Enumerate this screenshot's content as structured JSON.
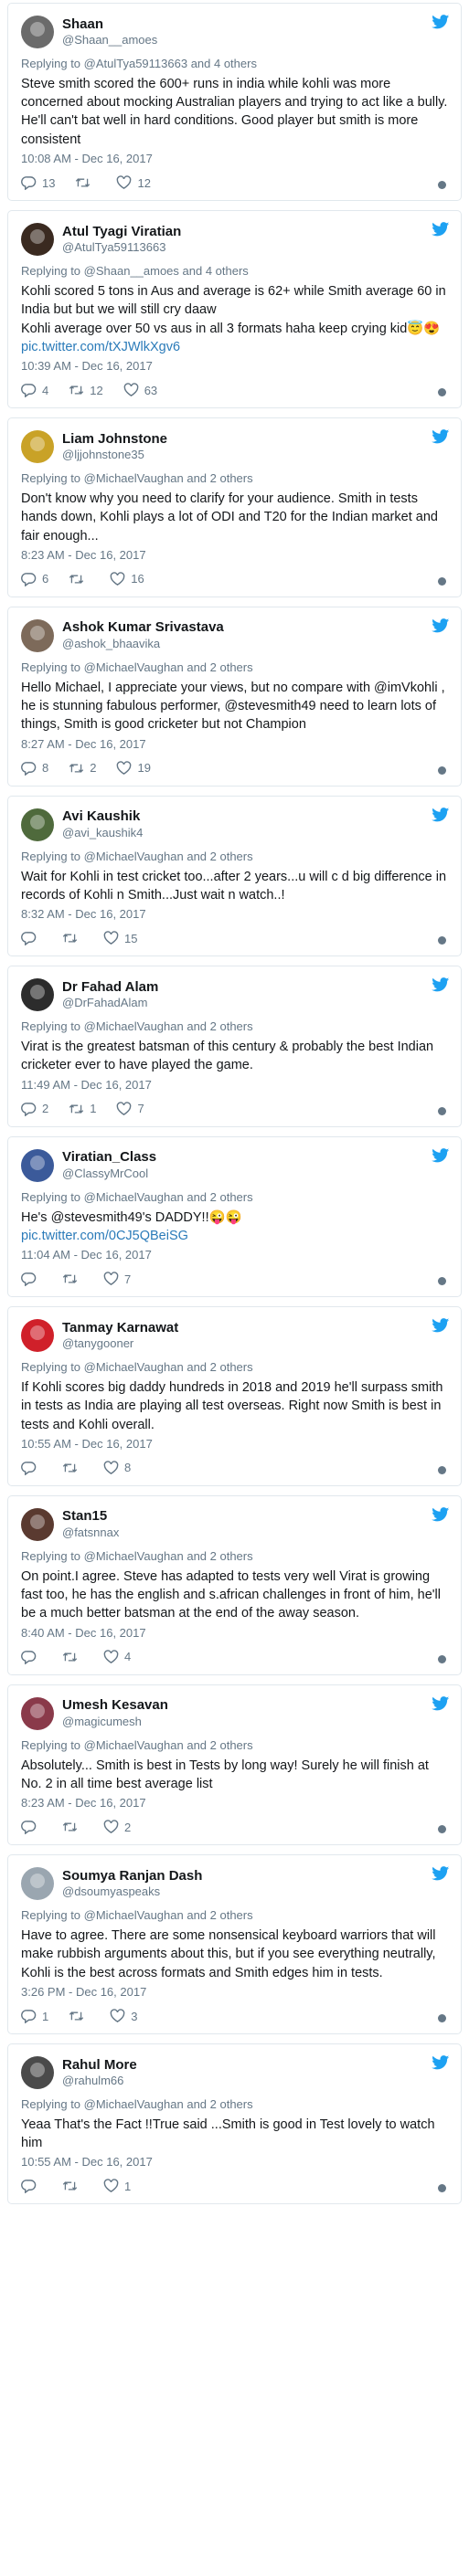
{
  "tweets": [
    {
      "name": "Shaan",
      "handle": "@Shaan__amoes",
      "avatar_color": "#6b6b6b",
      "replying": "Replying to @AtulTya59113663 and 4 others",
      "text": "Steve smith scored the 600+ runs in india while kohli was more concerned about mocking Australian players and trying to act like a bully. He'll can't bat well in hard conditions. Good player but smith is more consistent",
      "emoji": "",
      "link": "",
      "time": "10:08 AM - Dec 16, 2017",
      "replies": "13",
      "retweets": "",
      "likes": "12"
    },
    {
      "name": "Atul Tyagi Viratian",
      "handle": "@AtulTya59113663",
      "avatar_color": "#3a2a20",
      "replying": "Replying to @Shaan__amoes and 4 others",
      "text": "Kohli scored 5 tons in Aus and average is 62+ while Smith average 60 in India but but we will still cry daaw\nKohli average over 50 vs aus in all 3 formats haha keep crying kid",
      "emoji": "😇😍",
      "link": "pic.twitter.com/tXJWlkXgv6",
      "time": "10:39 AM - Dec 16, 2017",
      "replies": "4",
      "retweets": "12",
      "likes": "63"
    },
    {
      "name": "Liam Johnstone",
      "handle": "@ljjohnstone35",
      "avatar_color": "#c9a227",
      "replying": "Replying to @MichaelVaughan and 2 others",
      "text": "Don't know why you need to clarify for your audience. Smith in tests hands down, Kohli plays a lot of ODI and T20 for the Indian market and fair enough...",
      "emoji": "",
      "link": "",
      "time": "8:23 AM - Dec 16, 2017",
      "replies": "6",
      "retweets": "",
      "likes": "16"
    },
    {
      "name": "Ashok Kumar Srivastava",
      "handle": "@ashok_bhaavika",
      "avatar_color": "#7d6a5a",
      "replying": "Replying to @MichaelVaughan and 2 others",
      "text": "Hello Michael, I appreciate your views, but no compare with @imVkohli , he is stunning fabulous performer, @stevesmith49 need to learn lots of things, Smith is good cricketer but not Champion",
      "emoji": "",
      "link": "",
      "time": "8:27 AM - Dec 16, 2017",
      "replies": "8",
      "retweets": "2",
      "likes": "19"
    },
    {
      "name": "Avi Kaushik",
      "handle": "@avi_kaushik4",
      "avatar_color": "#4f6a3c",
      "replying": "Replying to @MichaelVaughan and 2 others",
      "text": "Wait for Kohli in test cricket too...after 2 years...u will c d big difference in records of Kohli n Smith...Just wait n watch..!",
      "emoji": "",
      "link": "",
      "time": "8:32 AM - Dec 16, 2017",
      "replies": "",
      "retweets": "",
      "likes": "15"
    },
    {
      "name": "Dr Fahad Alam",
      "handle": "@DrFahadAlam",
      "avatar_color": "#2c2c2c",
      "replying": "Replying to @MichaelVaughan and 2 others",
      "text": "Virat is the greatest batsman of this century & probably the best Indian cricketer ever to have played the game.",
      "emoji": "",
      "link": "",
      "time": "11:49 AM - Dec 16, 2017",
      "replies": "2",
      "retweets": "1",
      "likes": "7"
    },
    {
      "name": "Viratian_Class",
      "handle": "@ClassyMrCool",
      "avatar_color": "#3b5a9a",
      "replying": "Replying to @MichaelVaughan and 2 others",
      "text": "He's @stevesmith49's DADDY!!",
      "emoji": "😜😜",
      "link": "pic.twitter.com/0CJ5QBeiSG",
      "time": "11:04 AM - Dec 16, 2017",
      "replies": "",
      "retweets": "",
      "likes": "7"
    },
    {
      "name": "Tanmay Karnawat",
      "handle": "@tanygooner",
      "avatar_color": "#d0202a",
      "replying": "Replying to @MichaelVaughan and 2 others",
      "text": "If Kohli scores big daddy hundreds in 2018 and 2019 he'll surpass smith in tests as India are playing all test overseas. Right now Smith is best in tests and Kohli overall.",
      "emoji": "",
      "link": "",
      "time": "10:55 AM - Dec 16, 2017",
      "replies": "",
      "retweets": "",
      "likes": "8"
    },
    {
      "name": "Stan15",
      "handle": "@fatsnnax",
      "avatar_color": "#5a3a30",
      "replying": "Replying to @MichaelVaughan and 2 others",
      "text": "On point.I agree. Steve has adapted to tests very well Virat is growing fast too, he has the english and s.african challenges in front of him, he'll be a much better batsman at the end of the away season.",
      "emoji": "",
      "link": "",
      "time": "8:40 AM - Dec 16, 2017",
      "replies": "",
      "retweets": "",
      "likes": "4"
    },
    {
      "name": "Umesh Kesavan",
      "handle": "@magicumesh",
      "avatar_color": "#8a3a4a",
      "replying": "Replying to @MichaelVaughan and 2 others",
      "text": "Absolutely... Smith is best in Tests by long way! Surely he will finish at No. 2 in all time best average list",
      "emoji": "",
      "link": "",
      "time": "8:23 AM - Dec 16, 2017",
      "replies": "",
      "retweets": "",
      "likes": "2"
    },
    {
      "name": "Soumya Ranjan Dash",
      "handle": "@dsoumyaspeaks",
      "avatar_color": "#9aa6b0",
      "replying": "Replying to @MichaelVaughan and 2 others",
      "text": "Have to agree. There are some nonsensical keyboard warriors that will make rubbish arguments about this, but if you see everything neutrally, Kohli is the best across formats and Smith edges him in tests.",
      "emoji": "",
      "link": "",
      "time": "3:26 PM - Dec 16, 2017",
      "replies": "1",
      "retweets": "",
      "likes": "3"
    },
    {
      "name": "Rahul More",
      "handle": "@rahulm66",
      "avatar_color": "#4a4a4a",
      "replying": "Replying to @MichaelVaughan and 2 others",
      "text": "Yeaa That's the Fact !!True said ...Smith is good in Test lovely to watch him",
      "emoji": "",
      "link": "",
      "time": "10:55 AM - Dec 16, 2017",
      "replies": "",
      "retweets": "",
      "likes": "1"
    }
  ]
}
